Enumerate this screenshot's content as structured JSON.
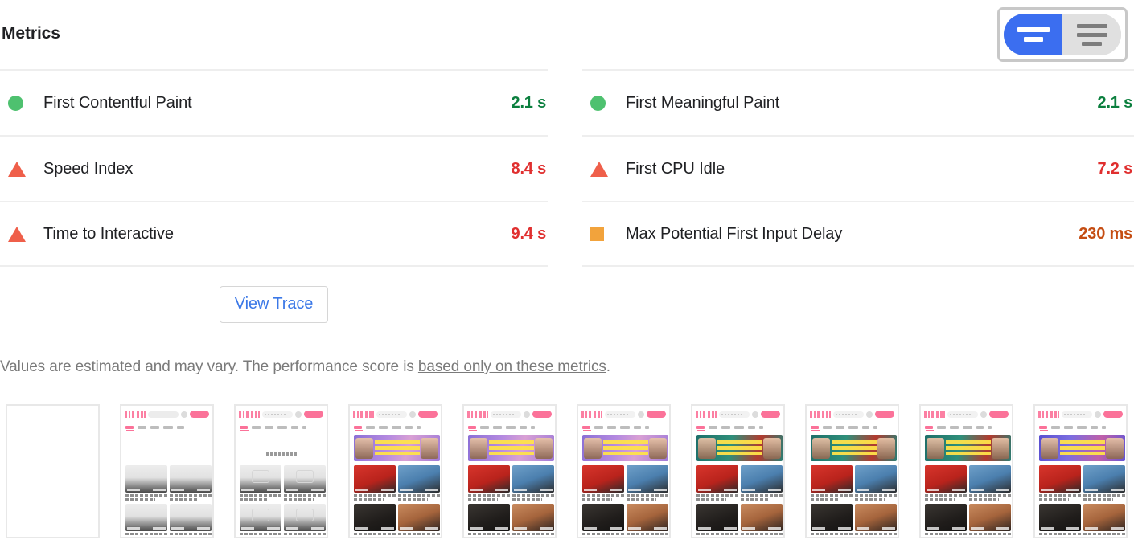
{
  "header": {
    "title": "Metrics",
    "toggle": {
      "name": "metrics-view-toggle",
      "active_option": "simple",
      "options": [
        {
          "id": "simple",
          "label": "Simple view",
          "bars": 2,
          "active": true
        },
        {
          "id": "expanded",
          "label": "Expanded view",
          "bars": 3,
          "active": false
        }
      ],
      "active_color": "#3b6ef0",
      "inactive_color": "#e0e0e0"
    }
  },
  "metrics": {
    "left_column": [
      {
        "icon": "pass-circle-icon",
        "status": "pass",
        "label": "First Contentful Paint",
        "value": "2.1 s"
      },
      {
        "icon": "fail-triangle-icon",
        "status": "fail",
        "label": "Speed Index",
        "value": "8.4 s"
      },
      {
        "icon": "fail-triangle-icon",
        "status": "fail",
        "label": "Time to Interactive",
        "value": "9.4 s"
      }
    ],
    "right_column": [
      {
        "icon": "pass-circle-icon",
        "status": "pass",
        "label": "First Meaningful Paint",
        "value": "2.1 s"
      },
      {
        "icon": "fail-triangle-icon",
        "status": "fail",
        "label": "First CPU Idle",
        "value": "7.2 s"
      },
      {
        "icon": "average-square-icon",
        "status": "average",
        "label": "Max Potential First Input Delay",
        "value": "230 ms"
      }
    ],
    "status_colors": {
      "pass": "#4ec16f",
      "fail": "#ef5f4a",
      "average": "#f2a33c",
      "pass_text": "#0b7f3e",
      "fail_text": "#e02f2f",
      "average_text": "#c54d12"
    }
  },
  "actions": {
    "view_trace_label": "View Trace",
    "view_trace_color": "#3b78e7"
  },
  "footnote": {
    "text_before": "Values are estimated and may vary. The performance score is ",
    "link_text": "based only on these metrics",
    "text_after": "."
  },
  "filmstrip": {
    "frame_count": 10,
    "frames": [
      {
        "index": 1,
        "state": "blank",
        "banner": "none",
        "cards": "none"
      },
      {
        "index": 2,
        "state": "chrome-only",
        "banner": "none",
        "cards": "placeholder-plain"
      },
      {
        "index": 3,
        "state": "skeleton",
        "banner": "none",
        "cards": "placeholder-icon"
      },
      {
        "index": 4,
        "state": "loaded",
        "banner": "purple",
        "cards": "images"
      },
      {
        "index": 5,
        "state": "loaded",
        "banner": "purple",
        "cards": "images"
      },
      {
        "index": 6,
        "state": "loaded",
        "banner": "purple",
        "cards": "images"
      },
      {
        "index": 7,
        "state": "loaded",
        "banner": "teal",
        "cards": "images"
      },
      {
        "index": 8,
        "state": "loaded",
        "banner": "teal",
        "cards": "images"
      },
      {
        "index": 9,
        "state": "loaded",
        "banner": "teal",
        "cards": "images"
      },
      {
        "index": 10,
        "state": "loaded",
        "banner": "blue",
        "cards": "images"
      }
    ]
  }
}
